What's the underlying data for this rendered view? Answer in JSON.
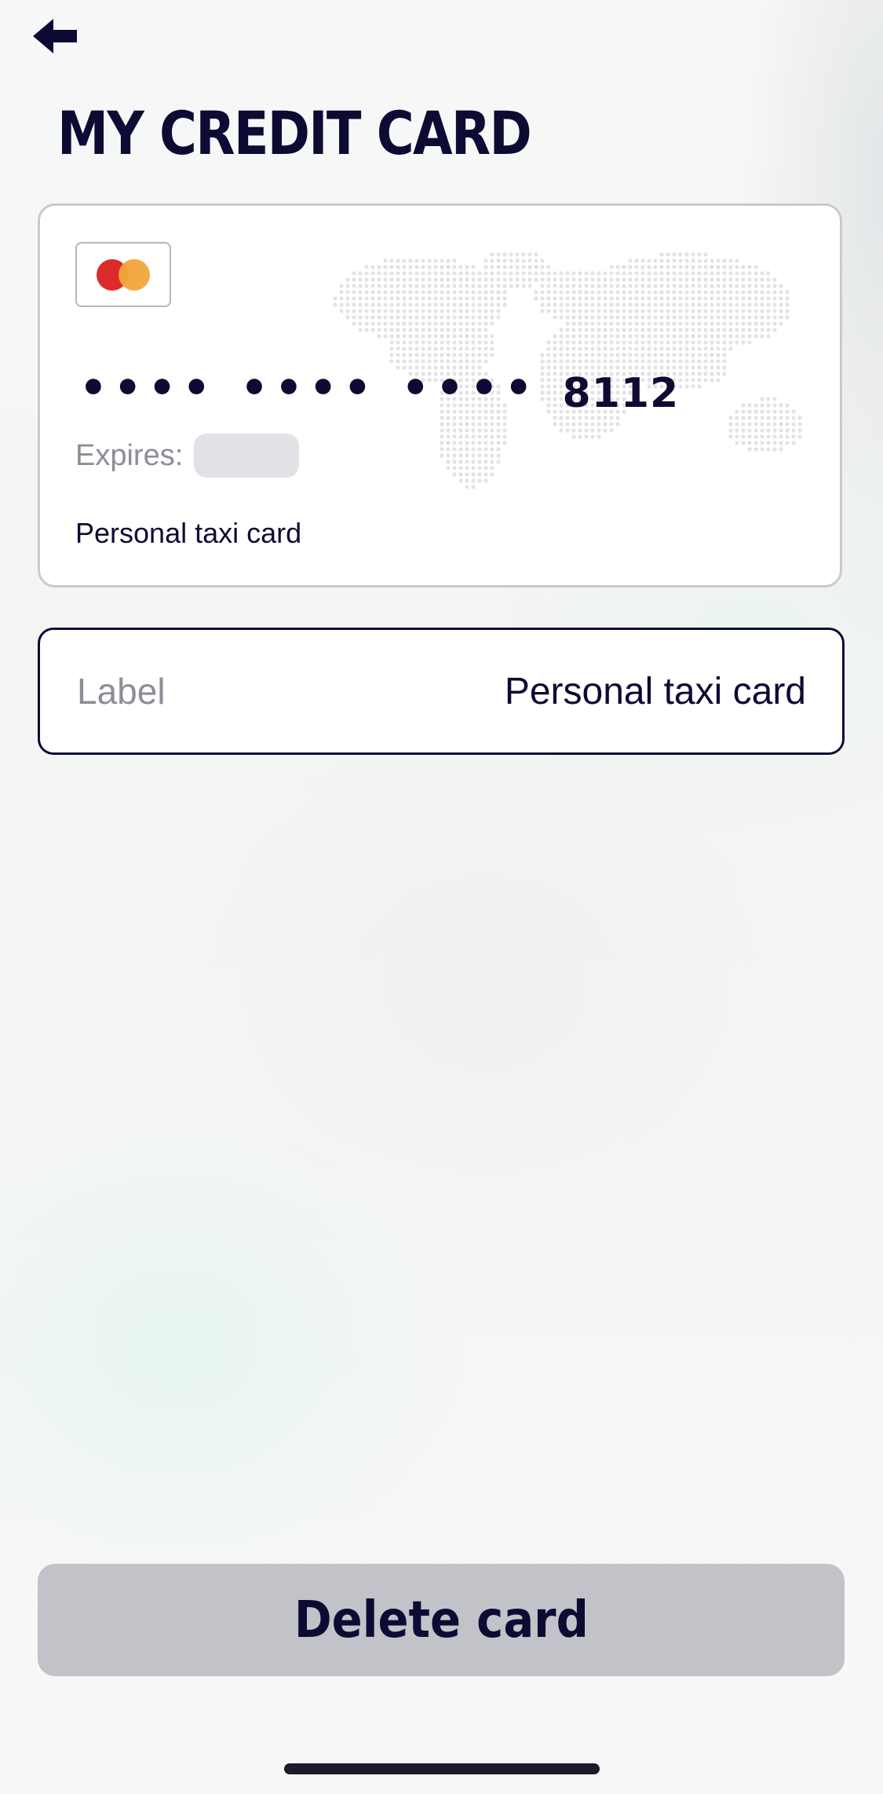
{
  "header": {
    "title": "MY CREDIT CARD",
    "back_icon": "arrow-left-icon"
  },
  "card": {
    "brand_icon": "mastercard-logo",
    "masked_groups": [
      "••••",
      "••••",
      "••••"
    ],
    "last_four": "8112",
    "expires_label": "Expires:",
    "card_label": "Personal taxi card",
    "background_icon": "world-map-dots"
  },
  "label_field": {
    "name": "Label",
    "value": "Personal taxi card"
  },
  "actions": {
    "delete_label": "Delete card"
  },
  "colors": {
    "primary_text": "#0d0b33",
    "muted_text": "#8d8d98",
    "button_bg": "#c2c2c9",
    "mastercard_red": "#dd2a2a",
    "mastercard_orange": "#f1a53a"
  }
}
